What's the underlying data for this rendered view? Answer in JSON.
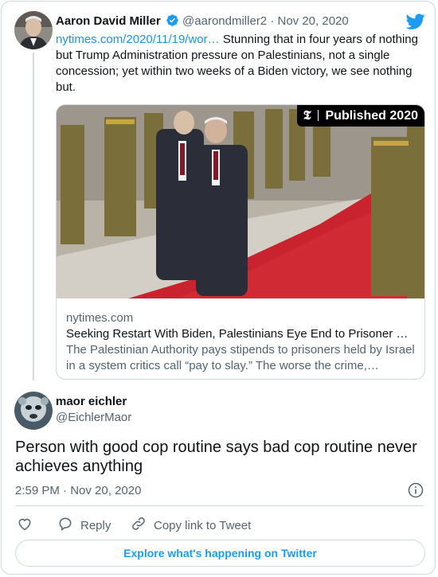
{
  "quoted": {
    "author_name": "Aaron David Miller",
    "author_handle": "@aarondmiller2",
    "separator": "·",
    "date": "Nov 20, 2020",
    "link": "nytimes.com/2020/11/19/wor…",
    "text": " Stunning that in four years of nothing but Trump Administration pressure on Palestinians, not a single concession; yet within two weeks of a Biden victory, we see nothing but.",
    "link_card": {
      "badge_logo": "𝕿",
      "badge_text": "Published 2020",
      "domain": "nytimes.com",
      "title": "Seeking Restart With Biden, Palestinians Eye End to Prisoner …",
      "description": "The Palestinian Authority pays stipends to prisoners held by Israel in a system critics call “pay to slay.” The worse the crime,…"
    }
  },
  "reply": {
    "author_name": "maor eichler",
    "author_handle": "@EichlerMaor",
    "text": "Person with good cop routine says bad cop routine never achieves anything",
    "time": "2:59 PM",
    "separator": "·",
    "date": "Nov 20, 2020"
  },
  "actions": {
    "reply_label": "Reply",
    "copy_link_label": "Copy link to Tweet"
  },
  "explore_label": "Explore what's happening on Twitter",
  "colors": {
    "link": "#1b95e0",
    "verified": "#1d9bf0",
    "twitter_bird": "#1d9bf0",
    "carpet": "#c8232f"
  },
  "icons": [
    "twitter-bird-icon",
    "verified-badge-icon",
    "info-icon",
    "heart-icon",
    "reply-icon",
    "link-icon"
  ]
}
